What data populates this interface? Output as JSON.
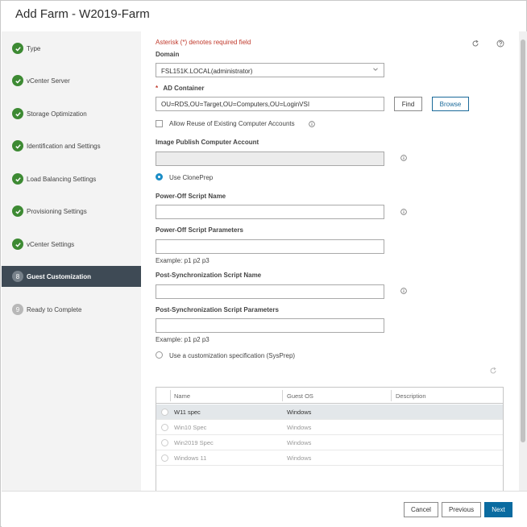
{
  "dialog": {
    "title": "Add Farm - W2019-Farm"
  },
  "sidebar": {
    "steps": [
      {
        "label": "Type",
        "status": "complete"
      },
      {
        "label": "vCenter Server",
        "status": "complete"
      },
      {
        "label": "Storage Optimization",
        "status": "complete"
      },
      {
        "label": "Identification and Settings",
        "status": "complete"
      },
      {
        "label": "Load Balancing Settings",
        "status": "complete"
      },
      {
        "label": "Provisioning Settings",
        "status": "complete"
      },
      {
        "label": "vCenter Settings",
        "status": "complete"
      },
      {
        "label": "Guest Customization",
        "number": "8",
        "status": "active"
      },
      {
        "label": "Ready to Complete",
        "number": "9",
        "status": "pending"
      }
    ]
  },
  "form": {
    "required_note": "Asterisk (*) denotes required field",
    "domain_label": "Domain",
    "domain_value": "FSL151K.LOCAL(administrator)",
    "ad_container_asterisk": "*",
    "ad_container_label": "AD Container",
    "ad_container_value": "OU=RDS,OU=Target,OU=Computers,OU=LoginVSI",
    "find_label": "Find",
    "browse_label": "Browse",
    "allow_reuse_label": "Allow Reuse of Existing Computer Accounts",
    "image_publish_label": "Image Publish Computer Account",
    "image_publish_value": "",
    "use_cloneprep_label": "Use ClonePrep",
    "poweroff_script_label": "Power-Off Script Name",
    "poweroff_script_value": "",
    "poweroff_params_label": "Power-Off Script Parameters",
    "poweroff_params_value": "",
    "poweroff_example": "Example: p1 p2 p3",
    "postsync_script_label": "Post-Synchronization Script Name",
    "postsync_script_value": "",
    "postsync_params_label": "Post-Synchronization Script Parameters",
    "postsync_params_value": "",
    "postsync_example": "Example: p1 p2 p3",
    "use_sysprep_label": "Use a customization specification (SysPrep)"
  },
  "spec_table": {
    "columns": [
      "Name",
      "Guest OS",
      "Description"
    ],
    "rows": [
      {
        "name": "W11 spec",
        "guest_os": "Windows",
        "description": "",
        "selected": true
      },
      {
        "name": "Win10 Spec",
        "guest_os": "Windows",
        "description": "",
        "selected": false
      },
      {
        "name": "Win2019 Spec",
        "guest_os": "Windows",
        "description": "",
        "selected": false
      },
      {
        "name": "Windows 11",
        "guest_os": "Windows",
        "description": "",
        "selected": false
      }
    ]
  },
  "footer": {
    "cancel_label": "Cancel",
    "previous_label": "Previous",
    "next_label": "Next"
  },
  "colors": {
    "accent": "#0a6ba0",
    "success": "#3d8a33",
    "active_step_bg": "#3e4a55",
    "required_text": "#c0392b"
  },
  "icons": [
    "check-icon",
    "refresh-icon",
    "help-icon",
    "info-icon",
    "chevron-down-icon"
  ]
}
